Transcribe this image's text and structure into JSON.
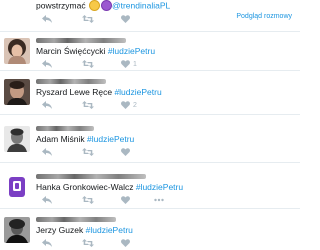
{
  "top_tweet": {
    "text_before": "powstrzymać",
    "mention": "@trendinaliaPL",
    "emoji_icons": [
      "grinning-face-icon",
      "smiling-devil-icon"
    ],
    "view_conversation": "Podgląd rozmowy"
  },
  "tweets": [
    {
      "text": "Marcin Święćcycki",
      "hashtag": "#ludziePetru",
      "retweets": "",
      "likes": "1"
    },
    {
      "text": "Ryszard Lewe Ręce",
      "hashtag": "#ludziePetru",
      "retweets": "",
      "likes": "2"
    },
    {
      "text": "Adam Miśnik",
      "hashtag": "#ludziePetru",
      "retweets": "",
      "likes": ""
    },
    {
      "text": "Hanka Gronkowiec-Walcz",
      "hashtag": "#ludziePetru",
      "retweets": "",
      "likes": ""
    },
    {
      "text": "Jerzy Guzek",
      "hashtag": "#ludziePetru",
      "retweets": "",
      "likes": ""
    }
  ],
  "icons": {
    "reply": "reply-icon",
    "retweet": "retweet-icon",
    "like": "heart-icon",
    "more": "more-dots-icon"
  },
  "colors": {
    "link": "#1b95e0",
    "action_gray": "#aab8c2",
    "text": "#14171a",
    "divider": "#e6ecf0"
  }
}
